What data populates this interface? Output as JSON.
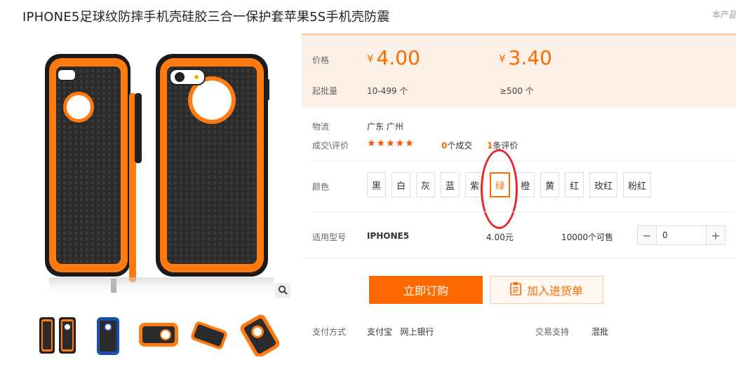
{
  "product": {
    "title": "IPHONE5足球纹防摔手机壳硅胶三合一保护套苹果5S手机壳防震",
    "right_cut_text": "本产品"
  },
  "price": {
    "label": "价格",
    "currency": "¥",
    "tiers": [
      {
        "price": "4.00",
        "min_qty": "10-499 个"
      },
      {
        "price": "3.40",
        "min_qty": "≥500 个"
      }
    ],
    "min_label": "起批量"
  },
  "logistics": {
    "label": "物流",
    "value": "广东 广州"
  },
  "rating": {
    "label": "成交\\评价",
    "stars": "★★★★★",
    "deals_count": "0",
    "deals_suffix": "个成交",
    "reviews_count": "1",
    "reviews_suffix": "条评价"
  },
  "color": {
    "label": "颜色",
    "options": [
      "黑",
      "白",
      "灰",
      "蓝",
      "紫",
      "绿",
      "橙",
      "黄",
      "红",
      "玫红",
      "粉红"
    ],
    "selected_index": 5
  },
  "model": {
    "label": "适用型号",
    "name": "IPHONE5",
    "price": "4.00元",
    "stock": "10000个可售",
    "quantity": "0",
    "minus": "−",
    "plus": "+"
  },
  "actions": {
    "order": "立即订购",
    "cart": "加入进货单"
  },
  "payment": {
    "label": "支付方式",
    "methods": "支付宝   网上银行",
    "support_label": "交易支持",
    "support_value": "混批"
  },
  "colors": {
    "accent": "#ff6a00",
    "price_bg": "#fdf1e7",
    "annotation": "#e5262b",
    "star": "#ff4f00"
  },
  "icons": {
    "zoom": "magnifier-icon",
    "cart": "clipboard-list-icon"
  }
}
